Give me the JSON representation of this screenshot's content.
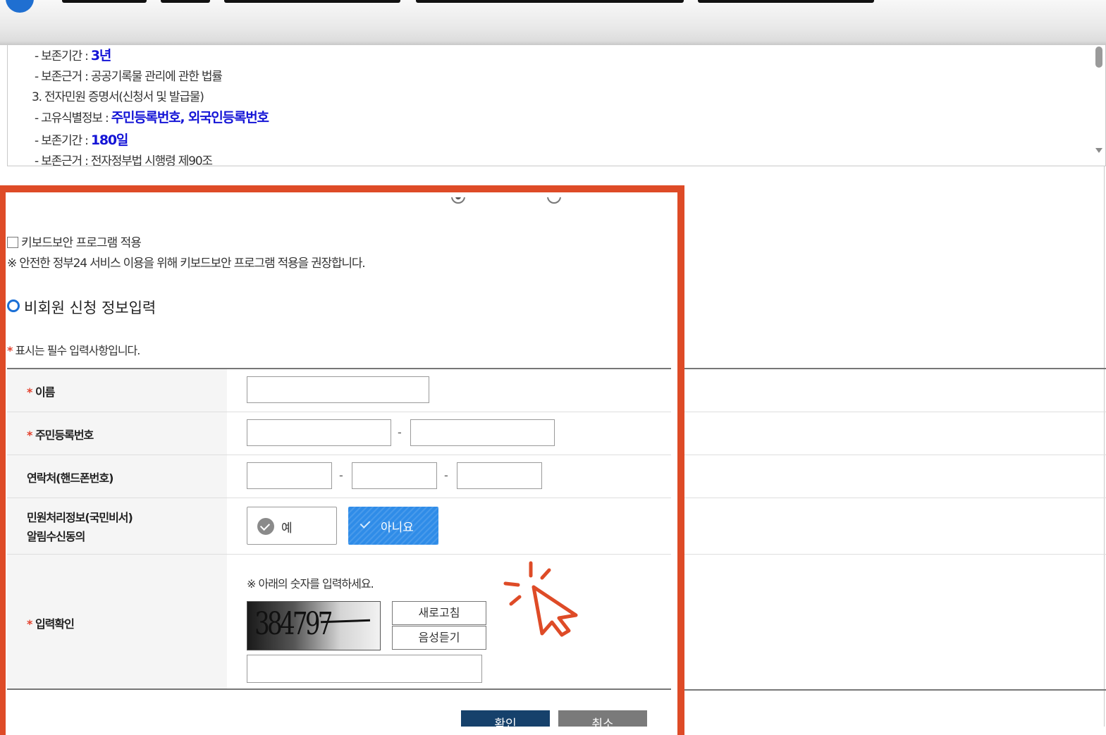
{
  "terms": {
    "lines": [
      {
        "text": "- 보존기간 : ",
        "highlight": "3년"
      },
      {
        "text": "- 보존근거 : 공공기록물 관리에 관한 법률",
        "highlight": ""
      },
      {
        "text": "3. 전자민원 증명서(신청서 및 발급물)",
        "highlight": ""
      },
      {
        "text": "- 고유식별정보 : ",
        "highlight": "주민등록번호, 외국인등록번호"
      },
      {
        "text": "- 보존기간 : ",
        "highlight": "180일"
      },
      {
        "text": "- 보존근거 : 전자정부법 시행령 제90조",
        "highlight": ""
      }
    ]
  },
  "keyboard_security": {
    "label": "키보드보안 프로그램 적용",
    "note": "※ 안전한 정부24 서비스 이용을 위해 키보드보안 프로그램 적용을 권장합니다."
  },
  "section": {
    "title": "비회원 신청 정보입력",
    "required_star": "*",
    "required_note": " 표시는 필수 입력사항입니다."
  },
  "form": {
    "name_label": "이름",
    "rrn_label": "주민등록번호",
    "phone_label": "연락처(핸드폰번호)",
    "consent_label_line1": "민원처리정보(국민비서)",
    "consent_label_line2": "알림수신동의",
    "consent_yes": "예",
    "consent_no": "아니요",
    "consent_selected": "아니요",
    "captcha_label": "입력확인",
    "captcha_note": "※ 아래의 숫자를 입력하세요.",
    "captcha_code": "384797",
    "refresh_button": "새로고침",
    "audio_button": "음성듣기",
    "dash": "-"
  },
  "actions": {
    "confirm": "확인",
    "cancel": "취소"
  },
  "colors": {
    "highlight_frame": "#de4b27",
    "accent_blue": "#2f8ce8",
    "confirm_button": "#16416b",
    "cancel_button": "#7a7a7a",
    "required_star": "#e3402c",
    "terms_highlight": "#1414d6"
  }
}
